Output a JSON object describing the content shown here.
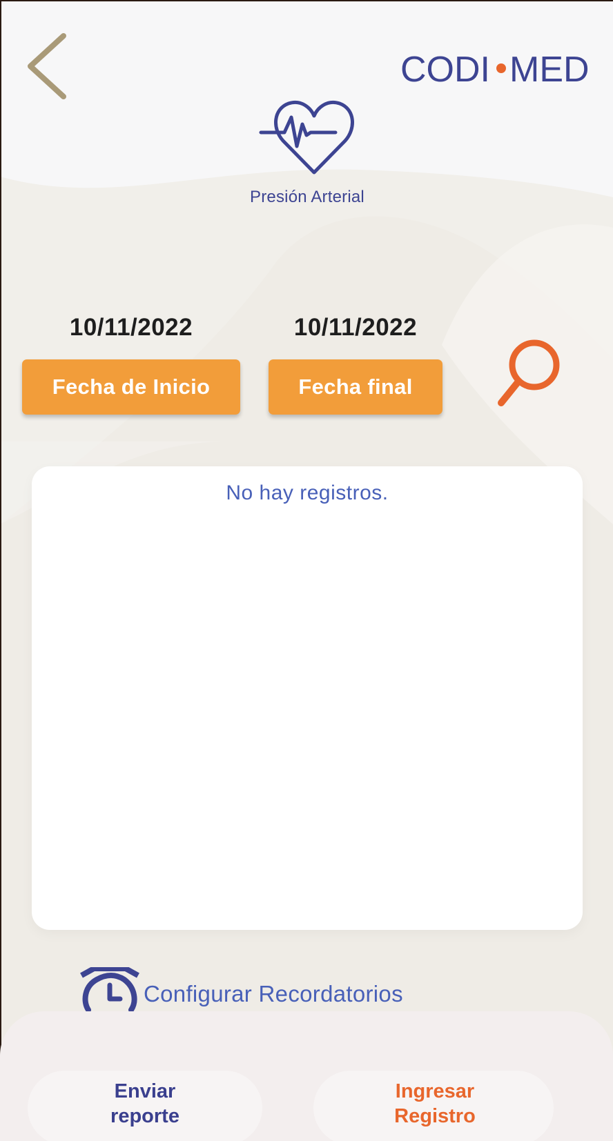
{
  "header": {
    "brand_name": "CODI•MED",
    "brand_left": "CODI",
    "brand_right": "MED",
    "back_icon": "chevron-left-icon"
  },
  "module": {
    "title": "Presión Arterial",
    "icon": "heart-pulse-icon"
  },
  "filters": {
    "start_date_value": "10/11/2022",
    "end_date_value": "10/11/2022",
    "start_button_label": "Fecha de Inicio",
    "end_button_label": "Fecha final",
    "search_icon": "search-icon"
  },
  "records": {
    "empty_message": "No hay registros."
  },
  "reminders": {
    "label": "Configurar Recordatorios",
    "icon": "alarm-clock-icon"
  },
  "bottom_bar": {
    "send_report_line1": "Enviar",
    "send_report_line2": "reporte",
    "add_record_line1": "Ingresar",
    "add_record_line2": "Registro"
  },
  "colors": {
    "primary_blue": "#3d4492",
    "accent_orange": "#f29d3a",
    "search_orange": "#e8662c",
    "text_blue": "#4860b8",
    "back_gold": "#a99a78"
  }
}
